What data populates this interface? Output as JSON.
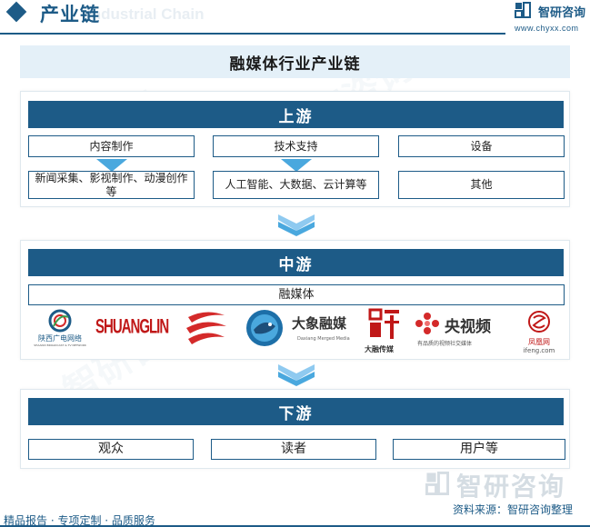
{
  "header": {
    "title": "产业链",
    "ghost_text": "Industrial Chain",
    "brand": "智研咨询",
    "url": "www.chyxx.com"
  },
  "diagram_title": "融媒体行业产业链",
  "upstream": {
    "label": "上游",
    "top_items": [
      "内容制作",
      "技术支持",
      "设备"
    ],
    "bottom_items": [
      "新闻采集、影视制作、动漫创作等",
      "人工智能、大数据、云计算等",
      "其他"
    ]
  },
  "midstream": {
    "label": "中游",
    "category": "融媒体",
    "logos": [
      {
        "name": "陕西广电网络",
        "sub": "SHAANXI BROADCAST & TV NETWORK"
      },
      {
        "name": "SHUANGLIN"
      },
      {
        "name": "swoosh-logo"
      },
      {
        "name": "fish-logo"
      },
      {
        "name": "大象融媒",
        "sub": "Daxiang Merged Media"
      },
      {
        "name": "大融传媒"
      },
      {
        "name": "央视频",
        "sub": "有品质的视频社交媒体"
      },
      {
        "name": "凤凰网",
        "sub": "ifeng.com"
      }
    ]
  },
  "downstream": {
    "label": "下游",
    "items": [
      "观众",
      "读者",
      "用户等"
    ]
  },
  "footer": {
    "brand": "智研咨询",
    "source": "资料来源：智研咨询整理",
    "slogan": "精品报告 · 专项定制 · 品质服务"
  },
  "colors": {
    "primary": "#1d5b87",
    "banner_bg": "#e4f0f8",
    "arrow": "#4aa8de",
    "logo_red": "#d42a2a"
  }
}
